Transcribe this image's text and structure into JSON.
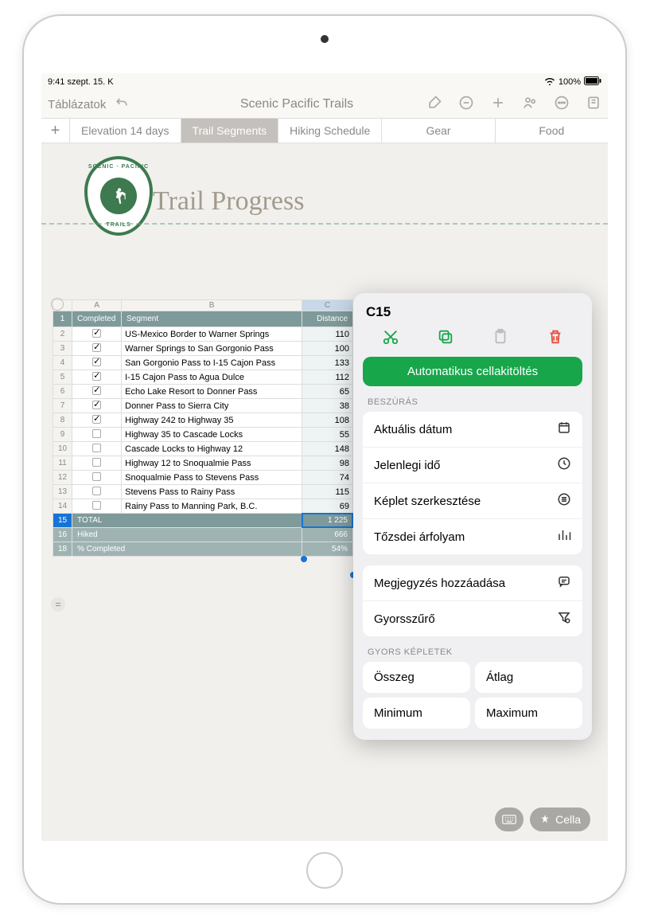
{
  "status": {
    "time": "9:41",
    "date": "szept. 15. K",
    "battery": "100%"
  },
  "toolbar": {
    "back": "Táblázatok",
    "title": "Scenic Pacific Trails"
  },
  "tabs": [
    {
      "label": "Elevation 14 days"
    },
    {
      "label": "Trail Segments"
    },
    {
      "label": "Hiking Schedule"
    },
    {
      "label": "Gear"
    },
    {
      "label": "Food"
    }
  ],
  "document": {
    "heading": "Trail Progress",
    "logo_top": "SCENIC · PACIFIC",
    "logo_bottom": "TRAILS"
  },
  "table": {
    "columns": [
      "A",
      "B",
      "C"
    ],
    "headers": {
      "a": "Completed",
      "b": "Segment",
      "c": "Distance"
    },
    "rows": [
      {
        "n": "2",
        "done": true,
        "seg": "US-Mexico Border to Warner Springs",
        "dist": "110"
      },
      {
        "n": "3",
        "done": true,
        "seg": "Warner Springs to San Gorgonio Pass",
        "dist": "100"
      },
      {
        "n": "4",
        "done": true,
        "seg": "San Gorgonio Pass to I-15 Cajon Pass",
        "dist": "133"
      },
      {
        "n": "5",
        "done": true,
        "seg": "I-15 Cajon Pass to Agua Dulce",
        "dist": "112"
      },
      {
        "n": "6",
        "done": true,
        "seg": "Echo Lake Resort to Donner Pass",
        "dist": "65"
      },
      {
        "n": "7",
        "done": true,
        "seg": "Donner Pass to Sierra City",
        "dist": "38"
      },
      {
        "n": "8",
        "done": true,
        "seg": "Highway 242 to Highway 35",
        "dist": "108"
      },
      {
        "n": "9",
        "done": false,
        "seg": "Highway 35 to Cascade Locks",
        "dist": "55"
      },
      {
        "n": "10",
        "done": false,
        "seg": "Cascade Locks to Highway 12",
        "dist": "148"
      },
      {
        "n": "11",
        "done": false,
        "seg": "Highway 12 to Snoqualmie Pass",
        "dist": "98"
      },
      {
        "n": "12",
        "done": false,
        "seg": "Snoqualmie Pass to Stevens Pass",
        "dist": "74"
      },
      {
        "n": "13",
        "done": false,
        "seg": "Stevens Pass to Rainy Pass",
        "dist": "115"
      },
      {
        "n": "14",
        "done": false,
        "seg": "Rainy Pass to Manning Park, B.C.",
        "dist": "69"
      }
    ],
    "footer": [
      {
        "n": "15",
        "label": "TOTAL",
        "val": "1 225"
      },
      {
        "n": "16",
        "label": "Hiked",
        "val": "666"
      },
      {
        "n": "18",
        "label": "% Completed",
        "val": "54%"
      }
    ]
  },
  "popover": {
    "cell": "C15",
    "autofill": "Automatikus cellakitöltés",
    "section_insert": "BESZÚRÁS",
    "insert": [
      {
        "label": "Aktuális dátum"
      },
      {
        "label": "Jelenlegi idő"
      },
      {
        "label": "Képlet szerkesztése"
      },
      {
        "label": "Tőzsdei árfolyam"
      }
    ],
    "extras": [
      {
        "label": "Megjegyzés hozzáadása"
      },
      {
        "label": "Gyorsszűrő"
      }
    ],
    "section_formulas": "GYORS KÉPLETEK",
    "formulas": [
      {
        "label": "Összeg"
      },
      {
        "label": "Átlag"
      },
      {
        "label": "Minimum"
      },
      {
        "label": "Maximum"
      }
    ]
  },
  "bottom": {
    "cell_label": "Cella"
  }
}
